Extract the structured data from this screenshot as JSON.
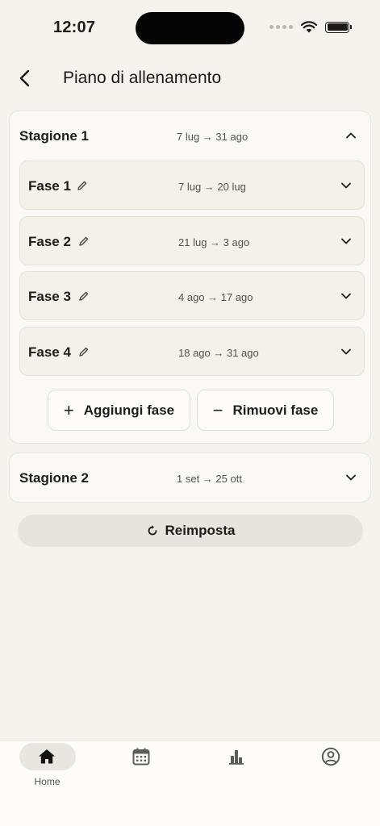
{
  "status_bar": {
    "time": "12:07"
  },
  "header": {
    "title": "Piano di allenamento"
  },
  "seasons": [
    {
      "name": "Stagione 1",
      "dates": "7 lug → 31 ago",
      "expanded": true,
      "phases": [
        {
          "name": "Fase 1",
          "dates": "7 lug → 20 lug"
        },
        {
          "name": "Fase 2",
          "dates": "21 lug → 3 ago"
        },
        {
          "name": "Fase 3",
          "dates": "4 ago → 17 ago"
        },
        {
          "name": "Fase 4",
          "dates": "18 ago → 31 ago"
        }
      ],
      "add_phase_label": "Aggiungi fase",
      "remove_phase_label": "Rimuovi fase"
    },
    {
      "name": "Stagione 2",
      "dates": "1 set → 25 ott",
      "expanded": false
    }
  ],
  "reset_label": "Reimposta",
  "tab_bar": {
    "tabs": [
      {
        "icon": "home-icon",
        "label": "Home",
        "active": true
      },
      {
        "icon": "calendar-icon",
        "label": "",
        "active": false
      },
      {
        "icon": "bar-chart-icon",
        "label": "",
        "active": false
      },
      {
        "icon": "profile-icon",
        "label": "",
        "active": false
      }
    ]
  },
  "colors": {
    "background": "#f6f3ee",
    "card": "#fbf9f6",
    "phase": "#f4f0ea",
    "reset_button": "#e7e3de",
    "text": "#1f1d1a"
  }
}
